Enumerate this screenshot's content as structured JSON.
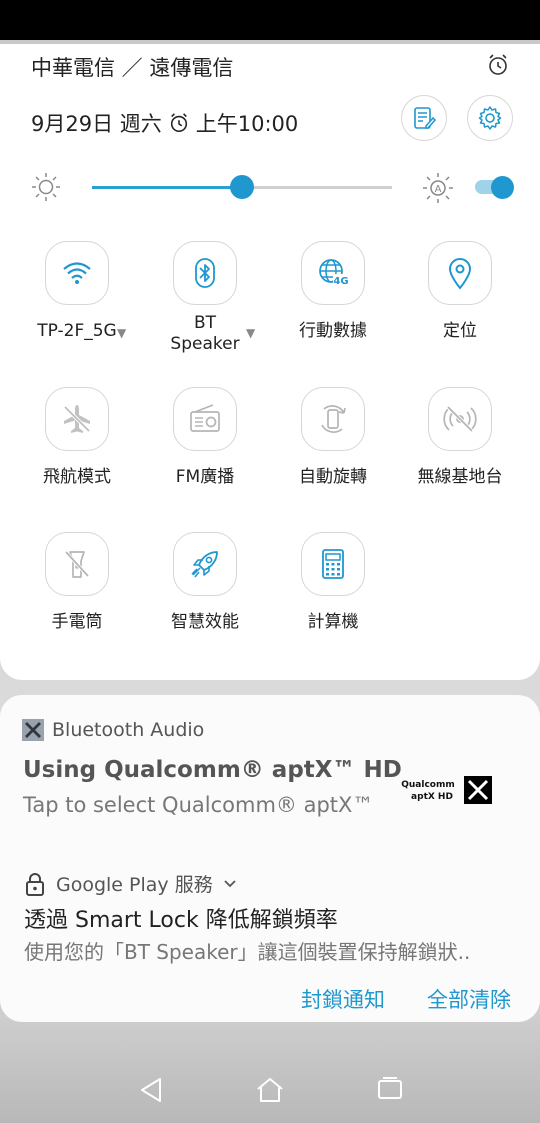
{
  "status": {
    "carrier": "中華電信 ／ 遠傳電信",
    "date": "9月29日 週六",
    "alarm_time": "上午10:00"
  },
  "brightness": {
    "level_fraction": 0.5,
    "auto_enabled": true
  },
  "tiles": [
    {
      "label": "TP-2F_5G",
      "icon": "wifi-icon",
      "active": true,
      "has_dropdown": true
    },
    {
      "label": "BT\nSpeaker",
      "icon": "bluetooth-icon",
      "active": true,
      "has_dropdown": true
    },
    {
      "label": "行動數據",
      "icon": "mobile-data-4g-icon",
      "active": true
    },
    {
      "label": "定位",
      "icon": "location-icon",
      "active": true
    },
    {
      "label": "飛航模式",
      "icon": "airplane-icon",
      "active": false
    },
    {
      "label": "FM廣播",
      "icon": "radio-icon",
      "active": false
    },
    {
      "label": "自動旋轉",
      "icon": "auto-rotate-icon",
      "active": false
    },
    {
      "label": "無線基地台",
      "icon": "hotspot-icon",
      "active": false
    },
    {
      "label": "手電筒",
      "icon": "flashlight-icon",
      "active": false
    },
    {
      "label": "智慧效能",
      "icon": "rocket-icon",
      "active": true
    },
    {
      "label": "計算機",
      "icon": "calculator-icon",
      "active": true
    }
  ],
  "notifications": [
    {
      "app": "Bluetooth Audio",
      "title": "Using Qualcomm® aptX™ HD",
      "text": "Tap to select Qualcomm® aptX™",
      "logo_line1": "Qualcomm",
      "logo_line2": "aptX HD"
    },
    {
      "app": "Google Play 服務",
      "title": "透過 Smart Lock 降低解鎖頻率",
      "text": "使用您的「BT Speaker」讓這個裝置保持解鎖狀.."
    }
  ],
  "actions": {
    "block": "封鎖通知",
    "clear_all": "全部清除"
  },
  "colors": {
    "accent": "#1f97cf",
    "inactive_icon": "#9a9a9a"
  }
}
